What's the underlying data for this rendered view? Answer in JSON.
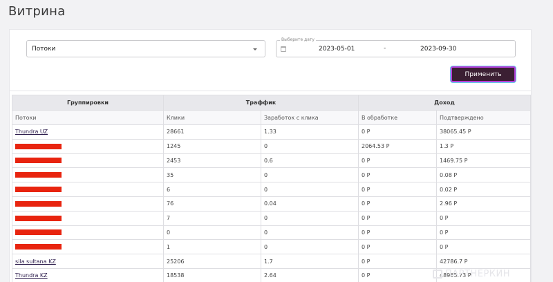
{
  "page": {
    "title": "Витрина"
  },
  "filters": {
    "grouping_select": {
      "value": "Потоки"
    },
    "date_range": {
      "legend": "Выберите дату",
      "from": "2023-05-01",
      "separator": "-",
      "to": "2023-09-30"
    },
    "apply_label": "Применить"
  },
  "table": {
    "groups": [
      "Группировки",
      "Траффик",
      "Доход"
    ],
    "columns": [
      "Потоки",
      "Клики",
      "Заработок с клика",
      "В обработке",
      "Подтверждено"
    ],
    "rows": [
      {
        "flow": "Thundra UZ",
        "redacted": false,
        "clicks": "28661",
        "epc": "1.33",
        "processing": "0 Р",
        "confirmed": "38065.45 Р"
      },
      {
        "flow": "",
        "redacted": true,
        "clicks": "1245",
        "epc": "0",
        "processing": "2064.53 Р",
        "confirmed": "1.3 Р"
      },
      {
        "flow": "",
        "redacted": true,
        "clicks": "2453",
        "epc": "0.6",
        "processing": "0 Р",
        "confirmed": "1469.75 Р"
      },
      {
        "flow": "",
        "redacted": true,
        "clicks": "35",
        "epc": "0",
        "processing": "0 Р",
        "confirmed": "0.08 Р"
      },
      {
        "flow": "",
        "redacted": true,
        "clicks": "6",
        "epc": "0",
        "processing": "0 Р",
        "confirmed": "0.02 Р"
      },
      {
        "flow": "",
        "redacted": true,
        "clicks": "76",
        "epc": "0.04",
        "processing": "0 Р",
        "confirmed": "2.96 Р"
      },
      {
        "flow": "",
        "redacted": true,
        "clicks": "7",
        "epc": "0",
        "processing": "0 Р",
        "confirmed": "0 Р"
      },
      {
        "flow": "",
        "redacted": true,
        "clicks": "0",
        "epc": "0",
        "processing": "0 Р",
        "confirmed": "0 Р"
      },
      {
        "flow": "",
        "redacted": true,
        "clicks": "1",
        "epc": "0",
        "processing": "0 Р",
        "confirmed": "0 Р"
      },
      {
        "flow": "sila sultana KZ",
        "redacted": false,
        "clicks": "25206",
        "epc": "1.7",
        "processing": "0 Р",
        "confirmed": "42786.7 Р"
      },
      {
        "flow": "Thundra KZ",
        "redacted": false,
        "clicks": "18538",
        "epc": "2.64",
        "processing": "0 Р",
        "confirmed": "48965.73 Р"
      }
    ]
  },
  "watermark": {
    "text": "ПАРТНЕРКИН"
  },
  "colors": {
    "accent": "#3b1f33",
    "redaction": "#e8240f",
    "button_border": "#b83fd9"
  }
}
